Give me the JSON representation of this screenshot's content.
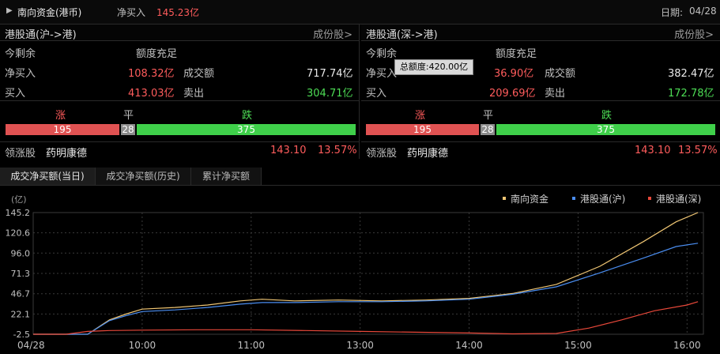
{
  "topbar": {
    "title": "南向资金(港币)",
    "net_label": "净买入",
    "net_value": "145.23亿",
    "date_label": "日期:",
    "date_value": "04/28"
  },
  "panels": [
    {
      "title": "港股通(沪->港)",
      "link": "成份股>",
      "remaining_label": "今剩余",
      "remaining_value": "额度充足",
      "net_label": "净买入",
      "net_value": "108.32亿",
      "turnover_label": "成交额",
      "turnover_value": "717.74亿",
      "buy_label": "买入",
      "buy_value": "413.03亿",
      "sell_label": "卖出",
      "sell_value": "304.71亿",
      "up_label": "涨",
      "flat_label": "平",
      "down_label": "跌",
      "up": "195",
      "flat": "28",
      "down": "375",
      "leader_label": "领涨股",
      "leader_name": "药明康德",
      "leader_price": "143.10",
      "leader_pct": "13.57%"
    },
    {
      "title": "港股通(深->港)",
      "link": "成份股>",
      "remaining_label": "今剩余",
      "remaining_value": "额度充足",
      "net_label": "净买入",
      "net_value": "36.90亿",
      "turnover_label": "成交额",
      "turnover_value": "382.47亿",
      "buy_label": "买入",
      "buy_value": "209.69亿",
      "sell_label": "卖出",
      "sell_value": "172.78亿",
      "up_label": "涨",
      "flat_label": "平",
      "down_label": "跌",
      "up": "195",
      "flat": "28",
      "down": "375",
      "leader_label": "领涨股",
      "leader_name": "药明康德",
      "leader_price": "143.10",
      "leader_pct": "13.57%"
    }
  ],
  "tooltip": "总额度:420.00亿",
  "tabs": [
    "成交净买额(当日)",
    "成交净买额(历史)",
    "累计净买额"
  ],
  "colors": {
    "up": "#e05252",
    "flat": "#8c8c8c",
    "down": "#3fd04a",
    "south": "#f0c674",
    "sh": "#4a8df0",
    "sz": "#e8483a"
  },
  "chart_data": {
    "type": "line",
    "ylabel": "(亿)",
    "yticks": [
      "145.2",
      "120.6",
      "96.0",
      "71.3",
      "46.7",
      "22.1",
      "-2.5"
    ],
    "ylim": [
      -2.5,
      145.2
    ],
    "xticks": [
      "04/28",
      "10:00",
      "11:00",
      "13:00",
      "14:00",
      "15:00",
      "16:00"
    ],
    "xtick_positions": [
      0,
      1,
      2,
      3,
      4,
      5,
      6
    ],
    "xlim": [
      0,
      6.15
    ],
    "series": [
      {
        "name": "南向资金",
        "color": "#f0c674",
        "x": [
          0,
          0.3,
          0.5,
          0.7,
          0.85,
          1.0,
          1.3,
          1.6,
          1.9,
          2.1,
          2.4,
          2.8,
          3.2,
          3.6,
          4.0,
          4.4,
          4.8,
          5.2,
          5.6,
          5.9,
          6.1
        ],
        "y": [
          -2.5,
          -2.5,
          -2.5,
          15,
          22,
          28,
          30,
          33,
          38,
          40,
          38,
          39,
          38,
          39,
          41,
          47,
          58,
          80,
          110,
          134,
          145.2
        ]
      },
      {
        "name": "港股通(沪)",
        "color": "#4a8df0",
        "x": [
          0,
          0.3,
          0.5,
          0.7,
          0.85,
          1.0,
          1.3,
          1.6,
          1.9,
          2.1,
          2.4,
          2.8,
          3.2,
          3.6,
          4.0,
          4.4,
          4.8,
          5.2,
          5.6,
          5.9,
          6.1
        ],
        "y": [
          -2.5,
          -2.5,
          -2.5,
          14,
          20,
          25,
          27,
          30,
          34,
          36,
          36,
          37,
          37,
          38,
          40,
          46,
          55,
          72,
          90,
          104,
          108
        ]
      },
      {
        "name": "港股通(深)",
        "color": "#e8483a",
        "x": [
          0,
          0.3,
          0.5,
          0.7,
          1.0,
          1.5,
          2.0,
          2.5,
          3.0,
          3.5,
          4.0,
          4.4,
          4.8,
          5.1,
          5.4,
          5.7,
          6.0,
          6.1
        ],
        "y": [
          -2.5,
          -2.5,
          1,
          2,
          2.5,
          3,
          3,
          2,
          1,
          0,
          -1,
          -2,
          -1.5,
          5,
          15,
          26,
          33,
          37
        ]
      }
    ],
    "legend": "top-right",
    "grid": true
  }
}
